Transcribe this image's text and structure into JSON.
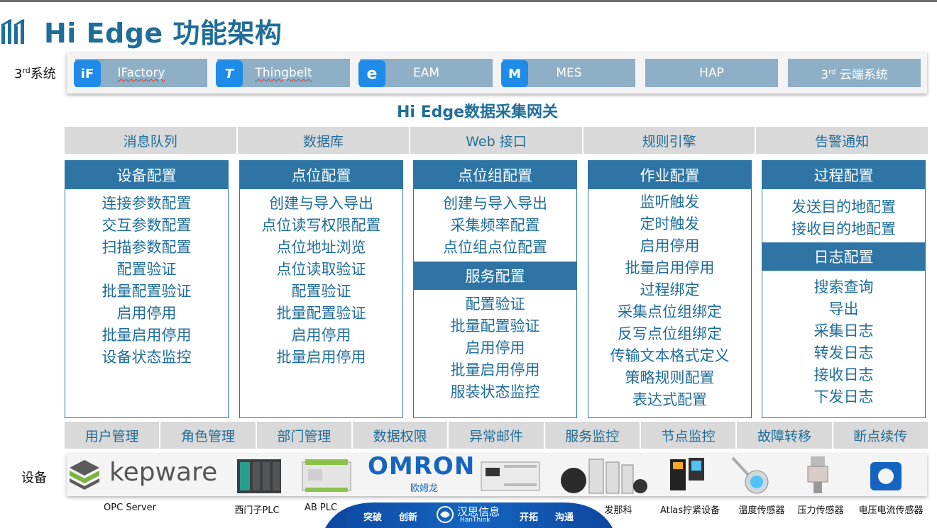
{
  "title": "Hi Edge 功能架构",
  "third_party": {
    "label_prefix": "3",
    "label_sup": "rd",
    "label_suffix": "系统",
    "systems": [
      {
        "name": "IFactory",
        "icon": "ifactory-icon",
        "icon_text": "iF"
      },
      {
        "name": "Thingbelt",
        "icon": "thingbelt-icon",
        "icon_text": "T"
      },
      {
        "name": "EAM",
        "icon": "eam-icon",
        "icon_text": "e"
      },
      {
        "name": "MES",
        "icon": "mes-icon",
        "icon_text": "M"
      },
      {
        "name": "HAP",
        "icon": null,
        "icon_text": ""
      },
      {
        "name_prefix": "3",
        "name_sup": "rd",
        "name_suffix": " 云端系统",
        "icon": null
      }
    ]
  },
  "gateway": {
    "title": "Hi Edge数据采集网关",
    "top_bar": [
      "消息队列",
      "数据库",
      "Web 接口",
      "规则引擎",
      "告警通知"
    ],
    "columns": [
      {
        "header": "设备配置",
        "items": [
          "连接参数配置",
          "交互参数配置",
          "扫描参数配置",
          "配置验证",
          "批量配置验证",
          "启用停用",
          "批量启用停用",
          "设备状态监控"
        ]
      },
      {
        "header": "点位配置",
        "items": [
          "创建与导入导出",
          "点位读写权限配置",
          "点位地址浏览",
          "点位读取验证",
          "配置验证",
          "批量配置验证",
          "启用停用",
          "批量启用停用"
        ]
      },
      {
        "header": "点位组配置",
        "items": [
          "创建与导入导出",
          "采集频率配置",
          "点位组点位配置"
        ],
        "sub_header": "服务配置",
        "sub_items": [
          "配置验证",
          "批量配置验证",
          "启用停用",
          "批量启用停用",
          "服装状态监控"
        ]
      },
      {
        "header": "作业配置",
        "items": [
          "监听触发",
          "定时触发",
          "启用停用",
          "批量启用停用",
          "过程绑定",
          "采集点位组绑定",
          "反写点位组绑定",
          "传输文本格式定义",
          "策略规则配置",
          "表达式配置"
        ]
      },
      {
        "header": "过程配置",
        "items": [
          "发送目的地配置",
          "接收目的地配置"
        ],
        "sub_header": "日志配置",
        "sub_items": [
          "搜索查询",
          "导出",
          "采集日志",
          "转发日志",
          "接收日志",
          "下发日志"
        ]
      }
    ],
    "bottom_bar": [
      "用户管理",
      "角色管理",
      "部门管理",
      "数据权限",
      "异常邮件",
      "服务监控",
      "节点监控",
      "故障转移",
      "断点续传"
    ]
  },
  "devices": {
    "label": "设备",
    "kepware_text": "kepware",
    "omron_text": "OMRON",
    "omron_sub": "欧姆龙",
    "items": [
      "OPC Server",
      "西门子PLC",
      "AB PLC",
      "发那科",
      "Atlas拧紧设备",
      "温度传感器",
      "压力传感器",
      "电压电流传感器"
    ]
  },
  "banner": {
    "left_words": [
      "突破",
      "创新"
    ],
    "brand_cn": "汉思信息",
    "brand_en": "HanThink",
    "right_words": [
      "开拓",
      "沟通"
    ]
  },
  "colors": {
    "title": "#1f6d99",
    "header_bg": "#2e75a6",
    "system_tile": "#8eafc6",
    "bar_bg": "#d9d9d9",
    "icon_blue": "#1f8be8"
  }
}
